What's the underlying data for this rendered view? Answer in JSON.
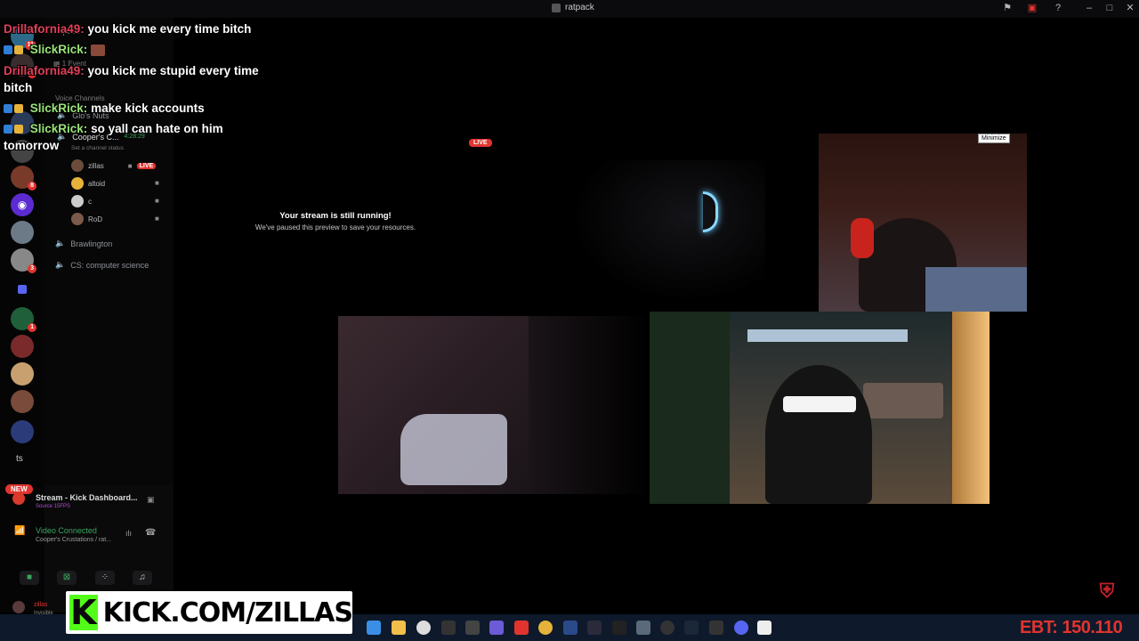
{
  "window": {
    "title": "ratpack"
  },
  "chat": [
    {
      "user": "Drillafornia49:",
      "message": "you kick me every time bitch",
      "color": "#e0405a"
    },
    {
      "user": "SlickRick:",
      "message": "",
      "color": "#9be37a"
    },
    {
      "user": "Drillafornia49:",
      "message": "you kick me stupid every time",
      "color": "#e0405a"
    },
    {
      "user": "",
      "message": "bitch",
      "color": "#ffffff"
    },
    {
      "user": "SlickRick:",
      "message": "make kick accounts",
      "color": "#9be37a"
    },
    {
      "user": "SlickRick:",
      "message": "so yall can hate on him",
      "color": "#9be37a"
    },
    {
      "user": "",
      "message": "tomorrow",
      "color": "#ffffff"
    }
  ],
  "sidebar": {
    "server_name": "ratpack",
    "events": "1 Event",
    "voice_header": "Voice Channels",
    "channels": [
      {
        "name": "Glo's Nuts"
      },
      {
        "name": "Cooper's C...",
        "timer": "4:28:29"
      }
    ],
    "channel_status": "Set a channel status",
    "voice_users": [
      {
        "name": "zillas",
        "live": "LIVE"
      },
      {
        "name": "altoid"
      },
      {
        "name": "c"
      },
      {
        "name": "RoD"
      }
    ],
    "other_channels": [
      "Brawlington",
      "CS: computer science"
    ]
  },
  "rail": {
    "new_label": "NEW",
    "ts_label": "ts",
    "badges": [
      "11",
      "2",
      "8",
      "3",
      "1"
    ]
  },
  "panel": {
    "stream_title": "Stream - Kick Dashboard...",
    "stream_sub": "Source 15FPS",
    "voice_status": "Video Connected",
    "voice_channel": "Cooper's Crustations / rat...",
    "user": "zillas",
    "user_status": "Invisible"
  },
  "stream": {
    "live_badge": "LIVE",
    "preview_title": "Your stream is still running!",
    "preview_sub": "We've paused this preview to save your resources.",
    "minimize_tip": "Minimize"
  },
  "overlay": {
    "kick_url": "KICK.COM/ZILLAS",
    "ebt": "EBT: 150.110"
  },
  "colors": {
    "live_red": "#e1342f",
    "kick_green": "#53fc18",
    "discord_green": "#3ba55d"
  }
}
